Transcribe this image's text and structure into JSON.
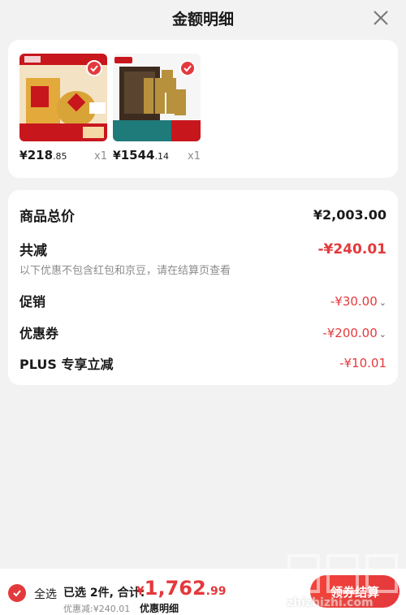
{
  "header": {
    "title": "金额明细"
  },
  "products": [
    {
      "price_currency": "¥",
      "price_int": "218",
      "price_dec": ".85",
      "qty": "x1"
    },
    {
      "price_currency": "¥",
      "price_int": "1544",
      "price_dec": ".14",
      "qty": "x1"
    }
  ],
  "summary": {
    "total_label": "商品总价",
    "total_value": "¥2,003.00",
    "reduce_label": "共减",
    "reduce_value": "-¥240.01",
    "note": "以下优惠不包含红包和京豆，请在结算页查看",
    "promo_label": "促销",
    "promo_value": "-¥30.00",
    "coupon_label": "优惠券",
    "coupon_value": "-¥200.00",
    "plus_label": "PLUS 专享立减",
    "plus_value": "-¥10.01"
  },
  "footer": {
    "select_all": "全选",
    "count_text": "已选 2件, 合计:",
    "total_currency": "¥",
    "total_int": "1,762",
    "total_dec": ".99",
    "discount": "优惠减:¥240.01",
    "detail_link": "优惠明细",
    "checkout": "领券结算"
  },
  "watermark": {
    "text": "zhizhizhi.com"
  },
  "colors": {
    "accent": "#e4393c",
    "muted": "#8c8c8c"
  }
}
